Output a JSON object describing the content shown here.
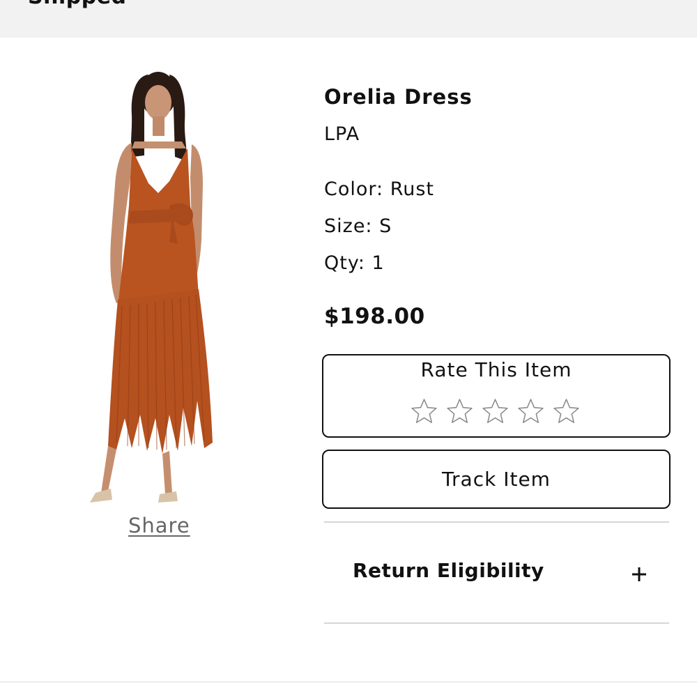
{
  "header": {
    "title": "Shipped"
  },
  "product": {
    "name": "Orelia Dress",
    "brand": "LPA",
    "color_line": "Color: Rust",
    "size_line": "Size: S",
    "qty_line": "Qty: 1",
    "price": "$198.00",
    "image": {
      "subject": "dress-photo",
      "accent_color": "#b95420"
    }
  },
  "share": {
    "label": "Share"
  },
  "rating": {
    "label": "Rate This Item",
    "max_stars": 5,
    "current": 0,
    "icon": "star-outline-icon"
  },
  "track": {
    "label": "Track Item"
  },
  "returns": {
    "label": "Return Eligibility",
    "icon": "plus-icon"
  },
  "colors": {
    "header_bg": "#f2f2f2",
    "border": "#111111",
    "divider": "#d6d6d6",
    "link": "#666666"
  }
}
